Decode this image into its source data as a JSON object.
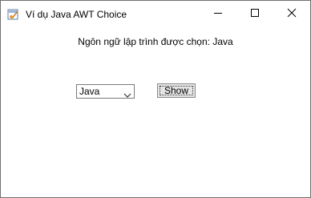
{
  "window": {
    "title": "Ví dụ Java AWT Choice",
    "controls": {
      "minimize": "minimize-icon",
      "maximize": "maximize-icon",
      "close": "close-icon"
    }
  },
  "content": {
    "heading": "Ngôn ngữ lập trình được chọn: Java",
    "choice": {
      "selected": "Java"
    },
    "show_button_label": "Show"
  }
}
